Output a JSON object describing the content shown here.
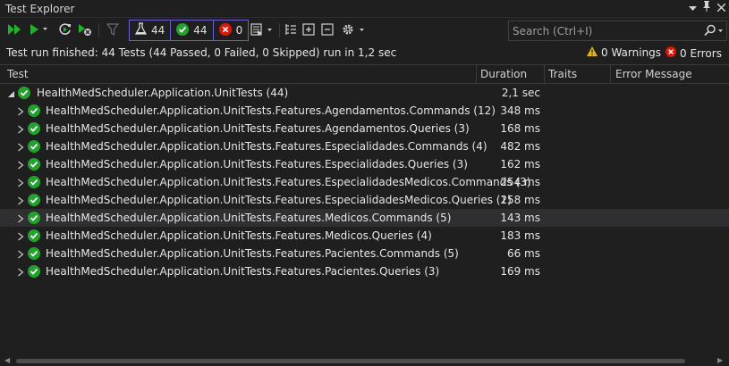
{
  "window": {
    "title": "Test Explorer"
  },
  "toolbar": {
    "counters": {
      "total": "44",
      "passed": "44",
      "failed": "0"
    }
  },
  "search": {
    "placeholder": "Search (Ctrl+I)"
  },
  "status": {
    "text": "Test run finished: 44 Tests (44 Passed, 0 Failed, 0 Skipped) run in 1,2 sec",
    "warnings": "0 Warnings",
    "errors": "0 Errors"
  },
  "columns": {
    "test": "Test",
    "duration": "Duration",
    "traits": "Traits",
    "error": "Error Message"
  },
  "tree": {
    "root": {
      "name": "HealthMedScheduler.Application.UnitTests (44)",
      "duration": "2,1 sec"
    },
    "items": [
      {
        "name": "HealthMedScheduler.Application.UnitTests.Features.Agendamentos.Commands (12)",
        "duration": "348 ms"
      },
      {
        "name": "HealthMedScheduler.Application.UnitTests.Features.Agendamentos.Queries (3)",
        "duration": "168 ms"
      },
      {
        "name": "HealthMedScheduler.Application.UnitTests.Features.Especialidades.Commands (4)",
        "duration": "482 ms"
      },
      {
        "name": "HealthMedScheduler.Application.UnitTests.Features.Especialidades.Queries (3)",
        "duration": "162 ms"
      },
      {
        "name": "HealthMedScheduler.Application.UnitTests.Features.EspecialidadesMedicos.Commands (3)",
        "duration": "254 ms"
      },
      {
        "name": "HealthMedScheduler.Application.UnitTests.Features.EspecialidadesMedicos.Queries (2)",
        "duration": "158 ms"
      },
      {
        "name": "HealthMedScheduler.Application.UnitTests.Features.Medicos.Commands (5)",
        "duration": "143 ms"
      },
      {
        "name": "HealthMedScheduler.Application.UnitTests.Features.Medicos.Queries (4)",
        "duration": "183 ms"
      },
      {
        "name": "HealthMedScheduler.Application.UnitTests.Features.Pacientes.Commands (5)",
        "duration": "66 ms"
      },
      {
        "name": "HealthMedScheduler.Application.UnitTests.Features.Pacientes.Queries (3)",
        "duration": "169 ms"
      }
    ]
  },
  "colors": {
    "pass": "#1fa32a",
    "fail": "#e51400",
    "accent": "#6b5fd6",
    "warning": "#e5b700"
  },
  "icons": [
    "run-all-icon",
    "run-icon",
    "repeat-last-run-icon",
    "debug-icon",
    "filter-icon",
    "flask-icon",
    "pass-icon",
    "fail-icon",
    "playlist-icon",
    "group-by-icon",
    "expand-all-icon",
    "collapse-all-icon",
    "settings-icon",
    "search-icon",
    "warning-icon",
    "error-icon"
  ]
}
